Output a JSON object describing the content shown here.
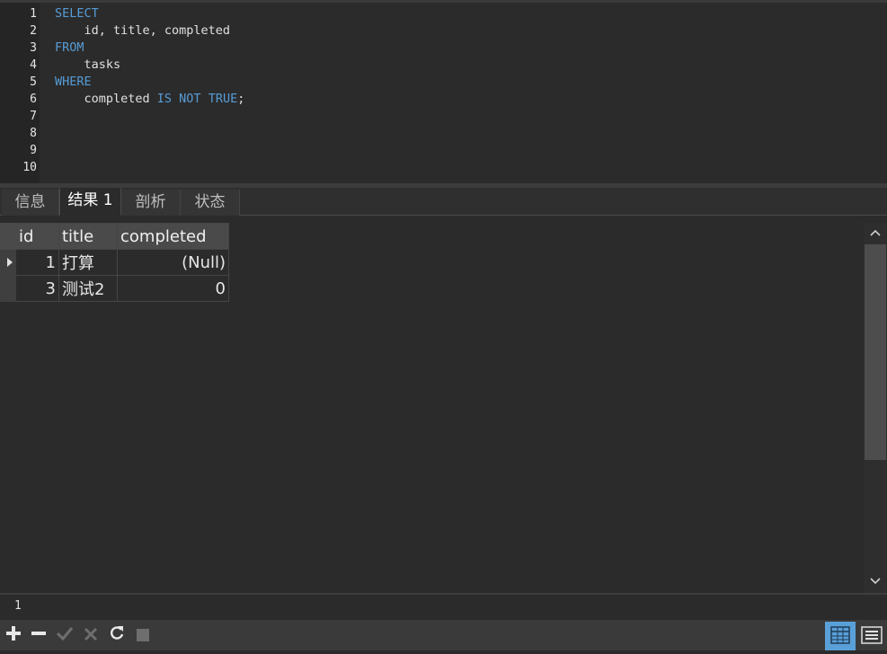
{
  "editor": {
    "line_numbers": [
      "1",
      "2",
      "3",
      "4",
      "5",
      "6",
      "7",
      "8",
      "9",
      "10"
    ],
    "lines": [
      {
        "parts": [
          {
            "t": "SELECT",
            "kw": true
          }
        ]
      },
      {
        "parts": [
          {
            "t": "    id, title, completed",
            "kw": false
          }
        ]
      },
      {
        "parts": [
          {
            "t": "FROM",
            "kw": true
          }
        ]
      },
      {
        "parts": [
          {
            "t": "    tasks",
            "kw": false
          }
        ]
      },
      {
        "parts": [
          {
            "t": "WHERE",
            "kw": true
          }
        ]
      },
      {
        "parts": [
          {
            "t": "    completed ",
            "kw": false
          },
          {
            "t": "IS NOT TRUE",
            "kw": true
          },
          {
            "t": ";",
            "kw": false
          }
        ]
      }
    ]
  },
  "tabs": [
    {
      "label": "信息",
      "active": false
    },
    {
      "label": "结果 1",
      "active": true
    },
    {
      "label": "剖析",
      "active": false
    },
    {
      "label": "状态",
      "active": false
    }
  ],
  "grid": {
    "columns": [
      "id",
      "title",
      "completed"
    ],
    "rows": [
      {
        "id": "1",
        "title": "打算",
        "completed": "(Null)",
        "current": true
      },
      {
        "id": "3",
        "title": "测试2",
        "completed": "0",
        "current": false
      }
    ]
  },
  "status": {
    "text": "1"
  },
  "toolbar": {
    "add": "add-icon",
    "remove": "minus-icon",
    "apply": "check-icon",
    "discard": "x-icon",
    "refresh": "refresh-icon",
    "stop": "stop-icon",
    "grid_view": "grid-view-icon",
    "form_view": "form-view-icon"
  },
  "colors": {
    "keyword": "#569cd6",
    "background": "#2b2b2b",
    "accent": "#5aa0d8",
    "null_text": "#7a7a7a"
  }
}
